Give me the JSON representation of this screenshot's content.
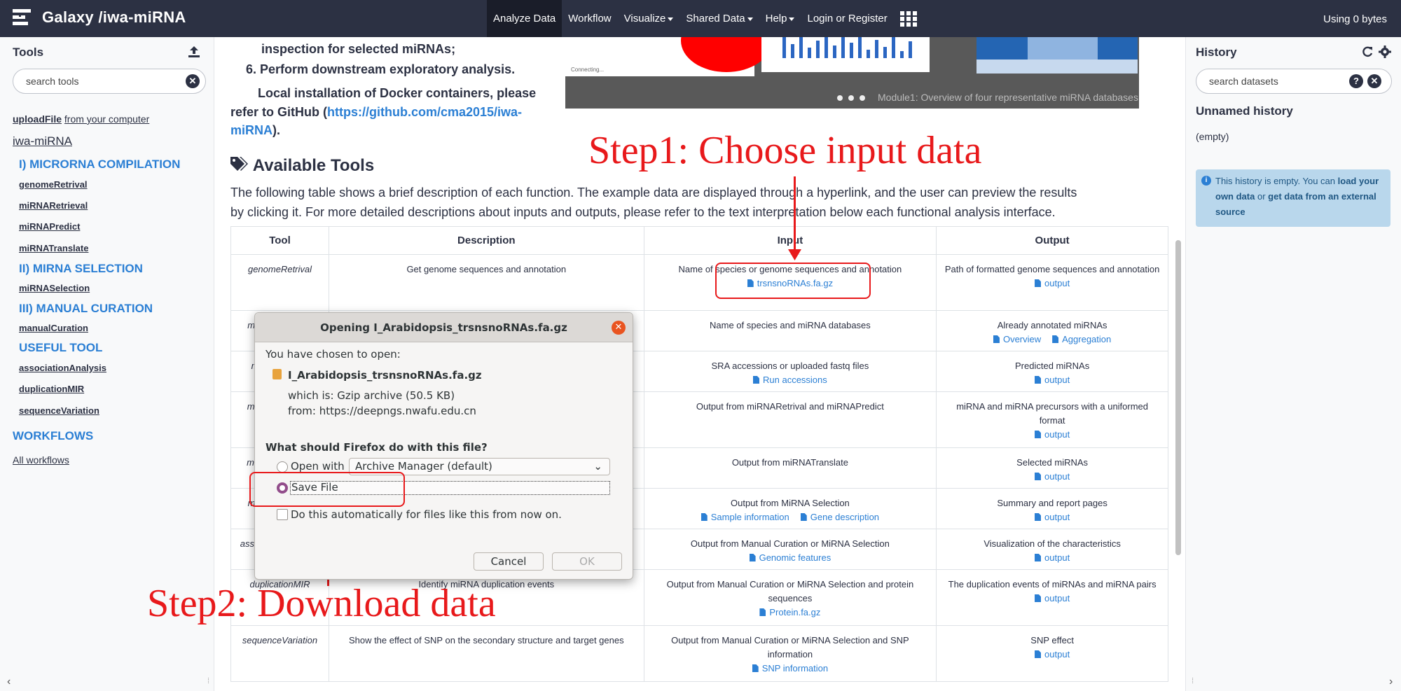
{
  "masthead": {
    "title": "Galaxy /iwa-miRNA",
    "nav": [
      "Analyze Data",
      "Workflow",
      "Visualize",
      "Shared Data",
      "Help",
      "Login or Register"
    ],
    "usage": "Using 0 bytes"
  },
  "tool_panel": {
    "title": "Tools",
    "search_placeholder": "search tools",
    "upload_link": "uploadFile",
    "upload_suffix": "from your computer",
    "section_title": "iwa-miRNA",
    "groups": [
      {
        "label": "I) MICRORNA COMPILATION",
        "tools": [
          "genomeRetrival",
          "miRNARetrieval",
          "miRNAPredict",
          "miRNATranslate"
        ]
      },
      {
        "label": "II) MIRNA SELECTION",
        "tools": [
          "miRNASelection"
        ]
      },
      {
        "label": "III) MANUAL CURATION",
        "tools": [
          "manualCuration"
        ]
      },
      {
        "label": "USEFUL TOOL",
        "tools": [
          "associationAnalysis",
          "duplicationMIR",
          "sequenceVariation"
        ]
      }
    ],
    "workflows_label": "WORKFLOWS",
    "all_workflows": "All workflows"
  },
  "center": {
    "intro_line1": "inspection for selected miRNAs;",
    "intro_line2": "6. Perform downstream exploratory analysis.",
    "docker_text1": "Local installation of Docker containers, please",
    "docker_text2": "refer to GitHub (",
    "docker_link1": "https://github.com/cma2015/iwa-",
    "docker_link2": "miRNA",
    "docker_end": ").",
    "carousel_caption": "Module1: Overview of four representative miRNA databases",
    "carousel_loading": "Connecting...",
    "available_title": "Available Tools",
    "description_line1": "The following table shows a brief description of each function. The example data are displayed through a hyperlink, and the user can preview the results",
    "description_line2": "by clicking it. For more detailed descriptions about inputs and outputs, please refer to the text interpretation below each functional analysis interface.",
    "table": {
      "headers": [
        "Tool",
        "Description",
        "Input",
        "Output"
      ],
      "rows": [
        {
          "tool": "genomeRetrival",
          "desc": "Get genome sequences and annotation",
          "input": "Name of species or genome sequences and annotation",
          "input_links": [
            "trsnsnoRNAs.fa.gz"
          ],
          "output": "Path of formatted genome sequences and annotation",
          "output_links": [
            "output"
          ]
        },
        {
          "tool": "miRNARetrieval",
          "desc": "",
          "input": "Name of species and miRNA databases",
          "input_links": [],
          "output": "Already annotated miRNAs",
          "output_links": [
            "Overview",
            "Aggregation"
          ]
        },
        {
          "tool": "miRNAPredict",
          "desc": "",
          "input": "SRA accessions or uploaded fastq files",
          "input_links": [
            "Run accessions"
          ],
          "output": "Predicted miRNAs",
          "output_links": [
            "output"
          ]
        },
        {
          "tool": "miRNATranslate",
          "desc": "",
          "input": "Output from miRNARetrival and miRNAPredict",
          "input_links": [],
          "output": "miRNA and miRNA precursors with a uniformed format",
          "output_links": [
            "output"
          ]
        },
        {
          "tool": "miRNASelection",
          "desc": "",
          "input": "Output from miRNATranslate",
          "input_links": [],
          "output": "Selected miRNAs",
          "output_links": [
            "output"
          ]
        },
        {
          "tool": "manualCuration",
          "desc": "",
          "input": "Output from MiRNA Selection",
          "input_links": [
            "Sample information",
            "Gene description"
          ],
          "output": "Summary and report pages",
          "output_links": [
            "output"
          ]
        },
        {
          "tool": "associationAnalysis",
          "desc": "",
          "input": "Output from Manual Curation or MiRNA Selection",
          "input_links": [
            "Genomic features"
          ],
          "output": "Visualization of the characteristics",
          "output_links": [
            "output"
          ]
        },
        {
          "tool": "duplicationMIR",
          "desc": "Identify miRNA duplication events",
          "input": "Output from Manual Curation or MiRNA Selection and protein sequences",
          "input_links": [
            "Protein.fa.gz"
          ],
          "output": "The duplication events of miRNAs and miRNA pairs",
          "output_links": [
            "output"
          ]
        },
        {
          "tool": "sequenceVariation",
          "desc": "Show the effect of SNP on the secondary structure and target genes",
          "input": "Output from Manual Curation or MiRNA Selection and SNP information",
          "input_links": [
            "SNP information"
          ],
          "output": "SNP effect",
          "output_links": [
            "output"
          ]
        }
      ]
    }
  },
  "annotations": {
    "step1": "Step1: Choose input data",
    "step2": "Step2: Download data",
    "color": "#e8191b"
  },
  "dialog": {
    "title": "Opening I_Arabidopsis_trsnsnoRNAs.fa.gz",
    "chosen_label": "You have chosen to open:",
    "filename": "I_Arabidopsis_trsnsnoRNAs.fa.gz",
    "which_is": "which is:  Gzip archive (50.5 KB)",
    "from": "from:  https://deepngs.nwafu.edu.cn",
    "question": "What should Firefox do with this file?",
    "open_with_label": "Open with",
    "open_with_value": "Archive Manager (default)",
    "save_file_label": "Save File",
    "auto_label": "Do this automatically for files like this from now on.",
    "cancel": "Cancel",
    "ok": "OK"
  },
  "history": {
    "title": "History",
    "search_placeholder": "search datasets",
    "name": "Unnamed history",
    "empty": "(empty)",
    "msg_prefix": "This history is empty. You can",
    "msg_link1": "load your own data",
    "msg_or": "or",
    "msg_link2": "get data from an external source"
  },
  "colors": {
    "masthead": "#2c3143",
    "link": "#2b7fd4",
    "dialog_accent": "#924d8b"
  }
}
